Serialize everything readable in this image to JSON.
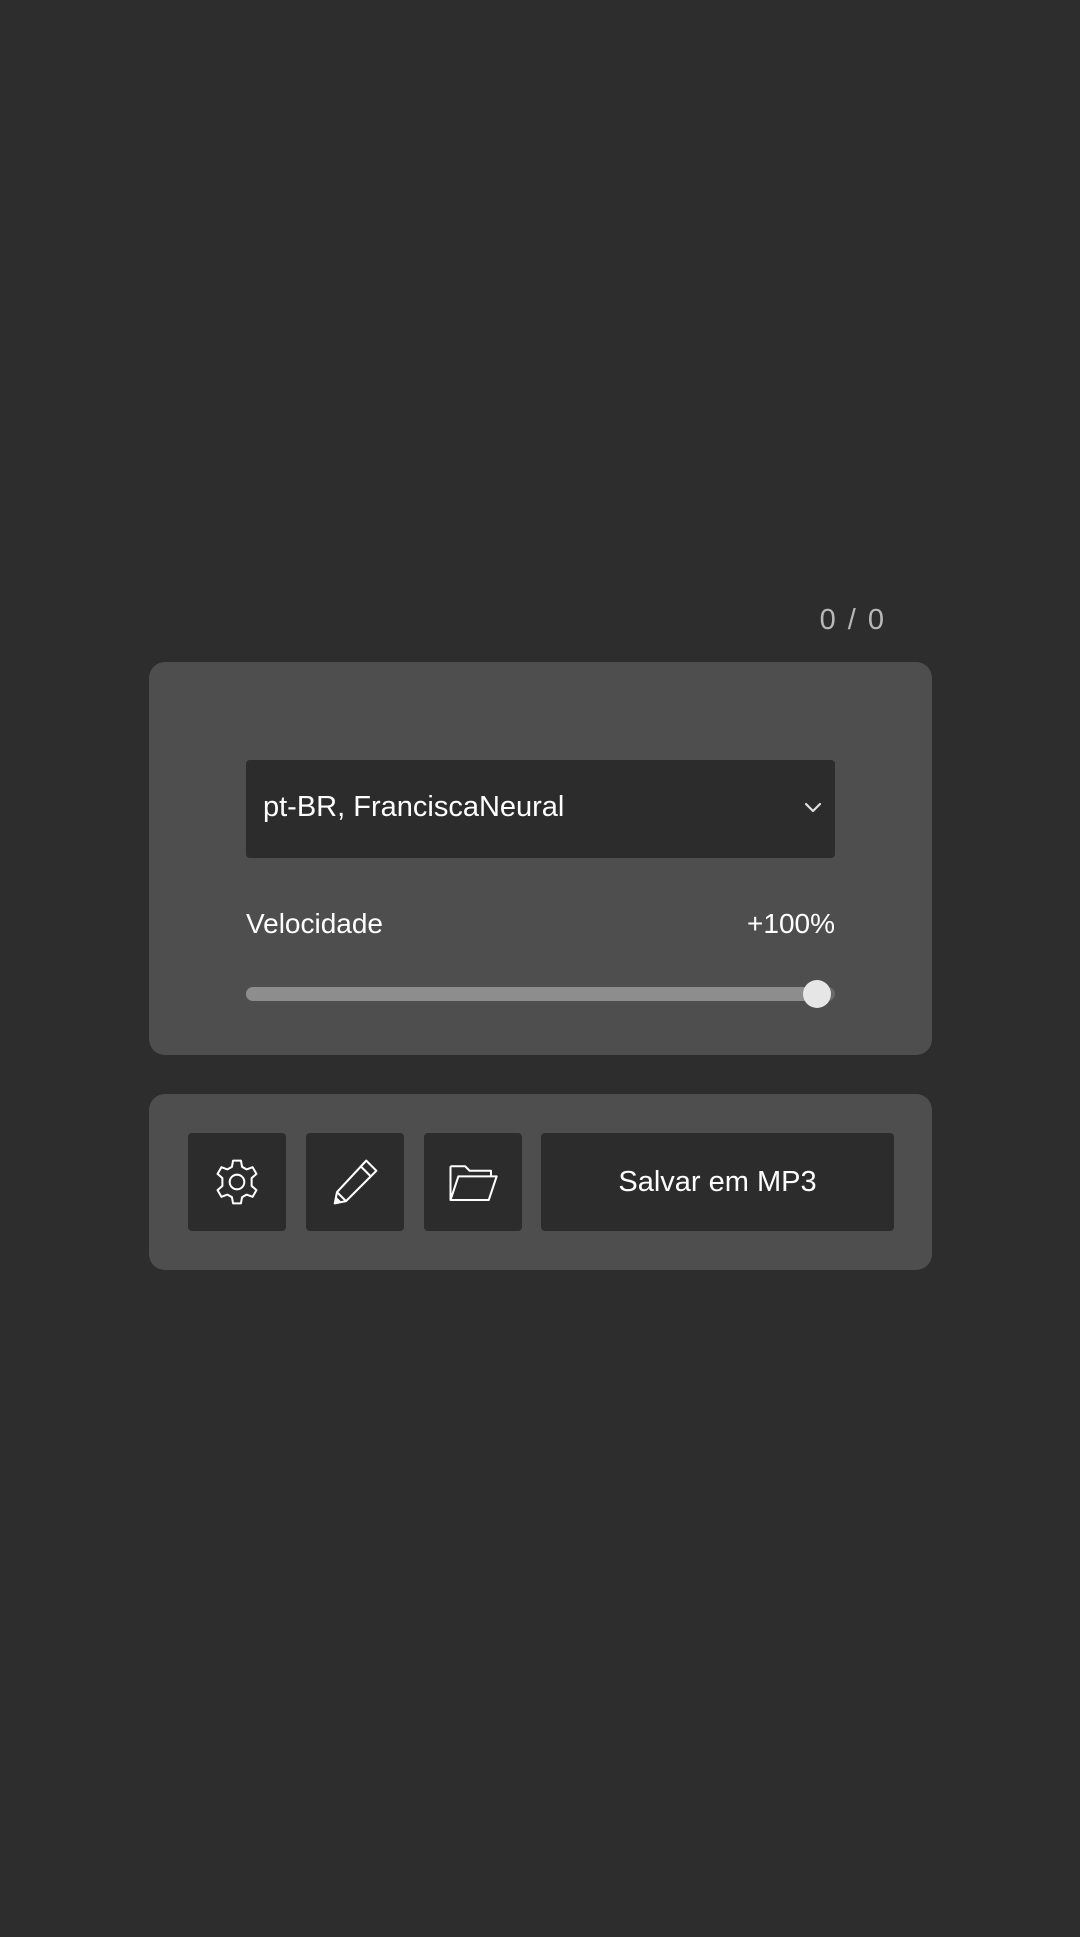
{
  "counter": {
    "text": "0 / 0"
  },
  "voice": {
    "selected": "pt-BR, FranciscaNeural"
  },
  "speed": {
    "label": "Velocidade",
    "value_text": "+100%",
    "slider_fraction": 0.97
  },
  "actions": {
    "settings_icon": "gear-icon",
    "edit_icon": "pencil-icon",
    "folder_icon": "folder-icon",
    "save_label": "Salvar em MP3"
  },
  "colors": {
    "background": "#2d2d2d",
    "panel": "#4e4e4e",
    "control": "#2c2c2c",
    "text": "#ffffff",
    "muted_text": "#b8b8b8"
  }
}
